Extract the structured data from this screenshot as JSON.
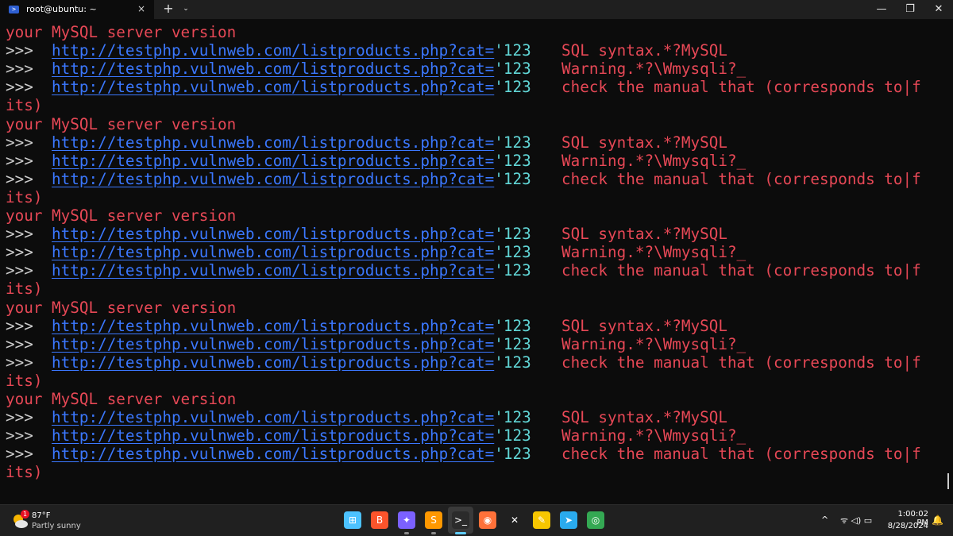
{
  "window": {
    "tab_title": "root@ubuntu: ~",
    "tab_icon": "PowerShell",
    "close_tab": "×",
    "new_tab": "+",
    "dropdown": "⌄",
    "minimize": "—",
    "maximize": "❐",
    "close": "✕"
  },
  "terminal": {
    "lines": [
      {
        "type": "red",
        "text": "your MySQL server version"
      },
      {
        "type": "entry",
        "prompt": ">>>",
        "url": "http://testphp.vulnweb.com/listproducts.php?cat=",
        "suffix": "'123",
        "tail": "SQL syntax.*?MySQL"
      },
      {
        "type": "entry",
        "prompt": ">>>",
        "url": "http://testphp.vulnweb.com/listproducts.php?cat=",
        "suffix": "'123",
        "tail": "Warning.*?\\Wmysqli?_"
      },
      {
        "type": "entry",
        "prompt": ">>>",
        "url": "http://testphp.vulnweb.com/listproducts.php?cat=",
        "suffix": "'123",
        "tail": "check the manual that (corresponds to|f"
      },
      {
        "type": "red",
        "text": "its)"
      },
      {
        "type": "red",
        "text": "your MySQL server version"
      },
      {
        "type": "entry",
        "prompt": ">>>",
        "url": "http://testphp.vulnweb.com/listproducts.php?cat=",
        "suffix": "'123",
        "tail": "SQL syntax.*?MySQL"
      },
      {
        "type": "entry",
        "prompt": ">>>",
        "url": "http://testphp.vulnweb.com/listproducts.php?cat=",
        "suffix": "'123",
        "tail": "Warning.*?\\Wmysqli?_"
      },
      {
        "type": "entry",
        "prompt": ">>>",
        "url": "http://testphp.vulnweb.com/listproducts.php?cat=",
        "suffix": "'123",
        "tail": "check the manual that (corresponds to|f"
      },
      {
        "type": "red",
        "text": "its)"
      },
      {
        "type": "red",
        "text": "your MySQL server version"
      },
      {
        "type": "entry",
        "prompt": ">>>",
        "url": "http://testphp.vulnweb.com/listproducts.php?cat=",
        "suffix": "'123",
        "tail": "SQL syntax.*?MySQL"
      },
      {
        "type": "entry",
        "prompt": ">>>",
        "url": "http://testphp.vulnweb.com/listproducts.php?cat=",
        "suffix": "'123",
        "tail": "Warning.*?\\Wmysqli?_"
      },
      {
        "type": "entry",
        "prompt": ">>>",
        "url": "http://testphp.vulnweb.com/listproducts.php?cat=",
        "suffix": "'123",
        "tail": "check the manual that (corresponds to|f"
      },
      {
        "type": "red",
        "text": "its)"
      },
      {
        "type": "red",
        "text": "your MySQL server version"
      },
      {
        "type": "entry",
        "prompt": ">>>",
        "url": "http://testphp.vulnweb.com/listproducts.php?cat=",
        "suffix": "'123",
        "tail": "SQL syntax.*?MySQL"
      },
      {
        "type": "entry",
        "prompt": ">>>",
        "url": "http://testphp.vulnweb.com/listproducts.php?cat=",
        "suffix": "'123",
        "tail": "Warning.*?\\Wmysqli?_"
      },
      {
        "type": "entry",
        "prompt": ">>>",
        "url": "http://testphp.vulnweb.com/listproducts.php?cat=",
        "suffix": "'123",
        "tail": "check the manual that (corresponds to|f"
      },
      {
        "type": "red",
        "text": "its)"
      },
      {
        "type": "red",
        "text": "your MySQL server version"
      },
      {
        "type": "entry",
        "prompt": ">>>",
        "url": "http://testphp.vulnweb.com/listproducts.php?cat=",
        "suffix": "'123",
        "tail": "SQL syntax.*?MySQL"
      },
      {
        "type": "entry",
        "prompt": ">>>",
        "url": "http://testphp.vulnweb.com/listproducts.php?cat=",
        "suffix": "'123",
        "tail": "Warning.*?\\Wmysqli?_"
      },
      {
        "type": "entry",
        "prompt": ">>>",
        "url": "http://testphp.vulnweb.com/listproducts.php?cat=",
        "suffix": "'123",
        "tail": "check the manual that (corresponds to|f"
      },
      {
        "type": "red",
        "text": "its)"
      }
    ]
  },
  "taskbar": {
    "weather_badge": "1",
    "weather_temp": "87°F",
    "weather_condition": "Partly sunny",
    "apps": [
      {
        "name": "start-icon",
        "glyph": "⊞",
        "color": "#4cc2ff"
      },
      {
        "name": "brave-icon",
        "glyph": "B",
        "color": "#fb542b"
      },
      {
        "name": "copilot-icon",
        "glyph": "✦",
        "color": "#7b61ff"
      },
      {
        "name": "sublime-icon",
        "glyph": "S",
        "color": "#ff9800"
      },
      {
        "name": "terminal-icon",
        "glyph": ">_",
        "color": "#2b2b2b"
      },
      {
        "name": "firefox-icon",
        "glyph": "◉",
        "color": "#ff7139"
      },
      {
        "name": "x-app-icon",
        "glyph": "✕",
        "color": "#202020"
      },
      {
        "name": "notes-icon",
        "glyph": "✎",
        "color": "#f7c600"
      },
      {
        "name": "telegram-icon",
        "glyph": "➤",
        "color": "#2aabee"
      },
      {
        "name": "chrome-icon",
        "glyph": "◎",
        "color": "#34a853"
      }
    ],
    "tray_chevron": "^",
    "tray_icons": "ᯤ ◁) ▭",
    "clock_time": "1:00:02 PM",
    "clock_date": "8/28/2024",
    "notification_glyph": "🔔"
  }
}
